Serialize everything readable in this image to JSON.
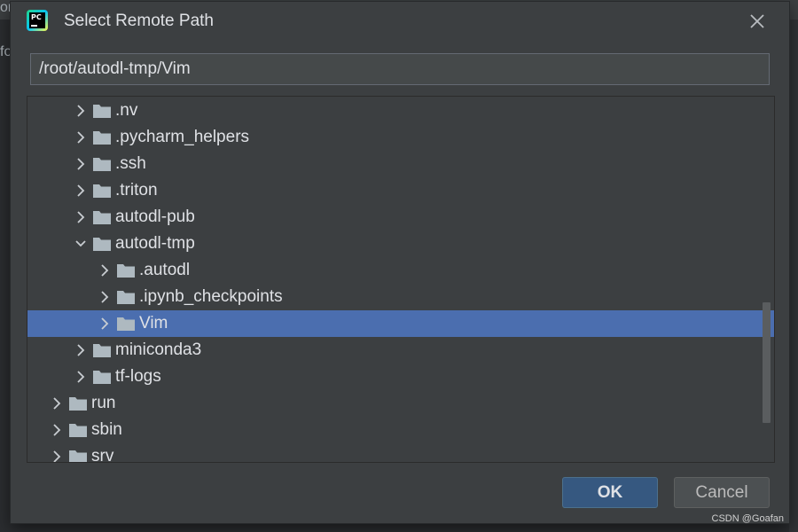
{
  "background": {
    "left_fragments": [
      "or",
      "fo"
    ]
  },
  "dialog": {
    "title": "Select Remote Path",
    "app_icon_text": "PC",
    "path_value": "/root/autodl-tmp/Vim",
    "tree_items": [
      {
        "label": ".nv",
        "depth": 2,
        "expanded": false,
        "selected": false
      },
      {
        "label": ".pycharm_helpers",
        "depth": 2,
        "expanded": false,
        "selected": false
      },
      {
        "label": ".ssh",
        "depth": 2,
        "expanded": false,
        "selected": false
      },
      {
        "label": ".triton",
        "depth": 2,
        "expanded": false,
        "selected": false
      },
      {
        "label": "autodl-pub",
        "depth": 2,
        "expanded": false,
        "selected": false
      },
      {
        "label": "autodl-tmp",
        "depth": 2,
        "expanded": true,
        "selected": false
      },
      {
        "label": ".autodl",
        "depth": 3,
        "expanded": false,
        "selected": false
      },
      {
        "label": ".ipynb_checkpoints",
        "depth": 3,
        "expanded": false,
        "selected": false
      },
      {
        "label": "Vim",
        "depth": 3,
        "expanded": false,
        "selected": true
      },
      {
        "label": "miniconda3",
        "depth": 2,
        "expanded": false,
        "selected": false
      },
      {
        "label": "tf-logs",
        "depth": 2,
        "expanded": false,
        "selected": false
      },
      {
        "label": "run",
        "depth": 1,
        "expanded": false,
        "selected": false
      },
      {
        "label": "sbin",
        "depth": 1,
        "expanded": false,
        "selected": false
      },
      {
        "label": "srv",
        "depth": 1,
        "expanded": false,
        "selected": false
      }
    ],
    "ok_label": "OK",
    "cancel_label": "Cancel"
  },
  "watermark": "CSDN @Goafan",
  "colors": {
    "selection": "#4b6eaf",
    "folder": "#aeb9c0",
    "chevron": "#c9cdd1"
  }
}
